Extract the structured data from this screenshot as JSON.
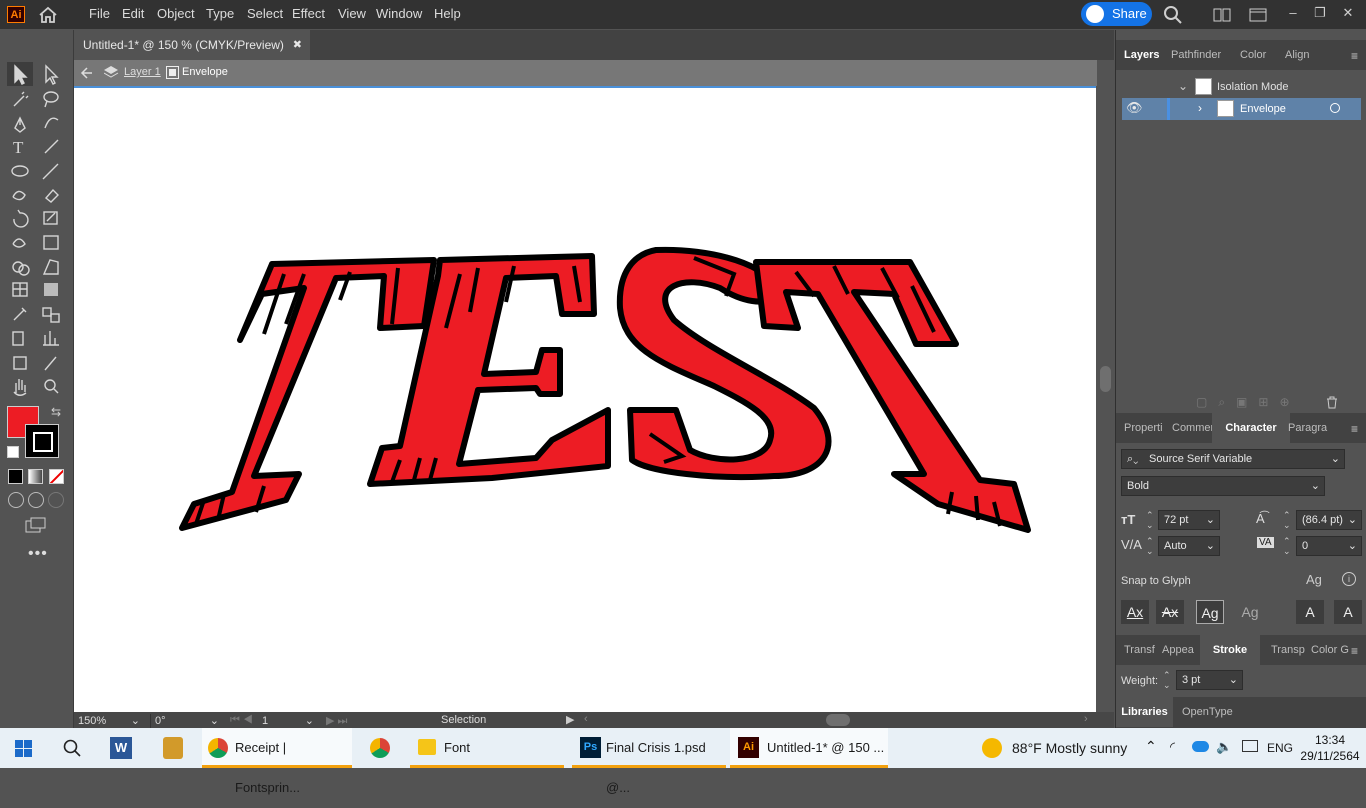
{
  "app": {
    "logo": "Ai"
  },
  "menu": [
    "File",
    "Edit",
    "Object",
    "Type",
    "Select",
    "Effect",
    "View",
    "Window",
    "Help"
  ],
  "share_label": "Share",
  "document": {
    "tab_title": "Untitled-1* @ 150 % (CMYK/Preview)",
    "breadcrumb": [
      "Layer 1",
      "Envelope"
    ],
    "artwork_text": "TEST",
    "artwork_fill": "#ed1c24",
    "artwork_stroke": "#000000"
  },
  "status": {
    "zoom": "150%",
    "rotation": "0°",
    "artboard": "1",
    "tool": "Selection"
  },
  "layers_panel": {
    "tabs": [
      "Layers",
      "Pathfinder",
      "Color",
      "Align"
    ],
    "rows": [
      {
        "label": "Isolation Mode"
      },
      {
        "label": "Envelope"
      }
    ]
  },
  "character_panel": {
    "tabs": [
      "Properti",
      "Commer",
      "Character",
      "Paragra"
    ],
    "font_family": "Source Serif Variable",
    "font_style": "Bold",
    "font_size": "72 pt",
    "leading": "(86.4 pt)",
    "kerning": "Auto",
    "tracking": "0",
    "snap_label": "Snap to Glyph"
  },
  "stroke_panel": {
    "tabs": [
      "Transf",
      "Appea",
      "Stroke",
      "Transp",
      "Color G"
    ],
    "weight_label": "Weight:",
    "weight_value": "3 pt"
  },
  "libraries_tabs": [
    "Libraries",
    "OpenType"
  ],
  "taskbar": {
    "items": [
      "Receipt | Fontsprin...",
      "Font",
      "Final Crisis 1.psd @...",
      "Untitled-1* @ 150 ..."
    ],
    "weather": "88°F  Mostly sunny",
    "language": "ENG",
    "time": "13:34",
    "date": "29/11/2564"
  },
  "colors": {
    "fill_swatch": "#ed1c24",
    "accent": "#1473e6",
    "taskbar_underline": "#f3a10e"
  }
}
